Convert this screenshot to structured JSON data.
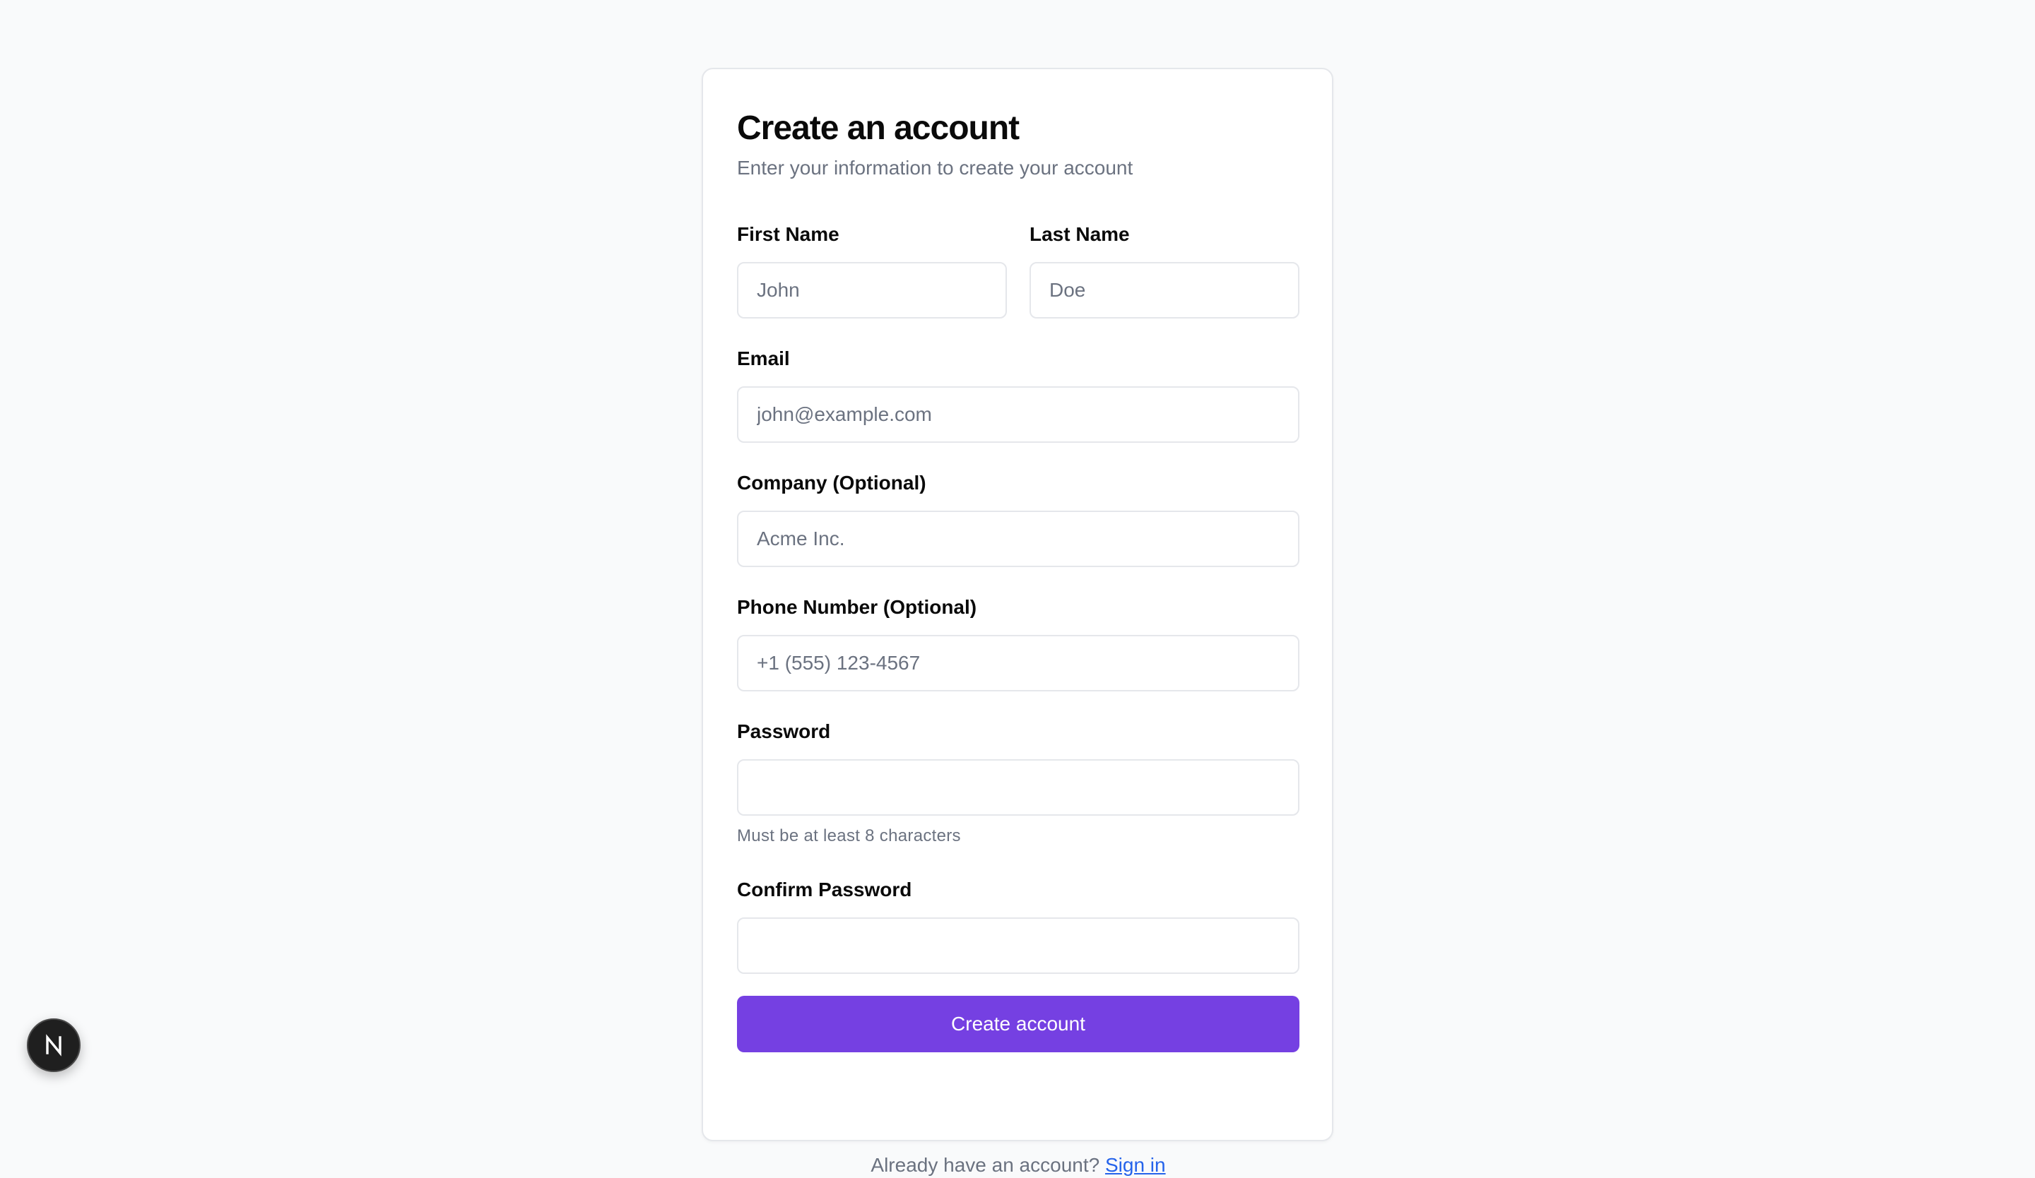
{
  "form": {
    "title": "Create an account",
    "subtitle": "Enter your information to create your account",
    "first_name": {
      "label": "First Name",
      "placeholder": "John",
      "value": ""
    },
    "last_name": {
      "label": "Last Name",
      "placeholder": "Doe",
      "value": ""
    },
    "email": {
      "label": "Email",
      "placeholder": "john@example.com",
      "value": ""
    },
    "company": {
      "label": "Company (Optional)",
      "placeholder": "Acme Inc.",
      "value": ""
    },
    "phone": {
      "label": "Phone Number (Optional)",
      "placeholder": "+1 (555) 123-4567",
      "value": ""
    },
    "password": {
      "label": "Password",
      "value": "",
      "hint": "Must be at least 8 characters"
    },
    "confirm_password": {
      "label": "Confirm Password",
      "value": ""
    },
    "submit_label": "Create account",
    "footer": {
      "text": "Already have an account?",
      "link_label": "Sign in"
    }
  },
  "overlay": {
    "badge_icon": "nextjs-logo-icon",
    "badge_letter": "N"
  },
  "colors": {
    "page_background": "#f9fafb",
    "card_background": "#ffffff",
    "border": "#e5e7eb",
    "primary_button": "#7540e2",
    "muted_text": "#6b7280",
    "link": "#2563eb",
    "badge_background": "#1f1f1f"
  }
}
